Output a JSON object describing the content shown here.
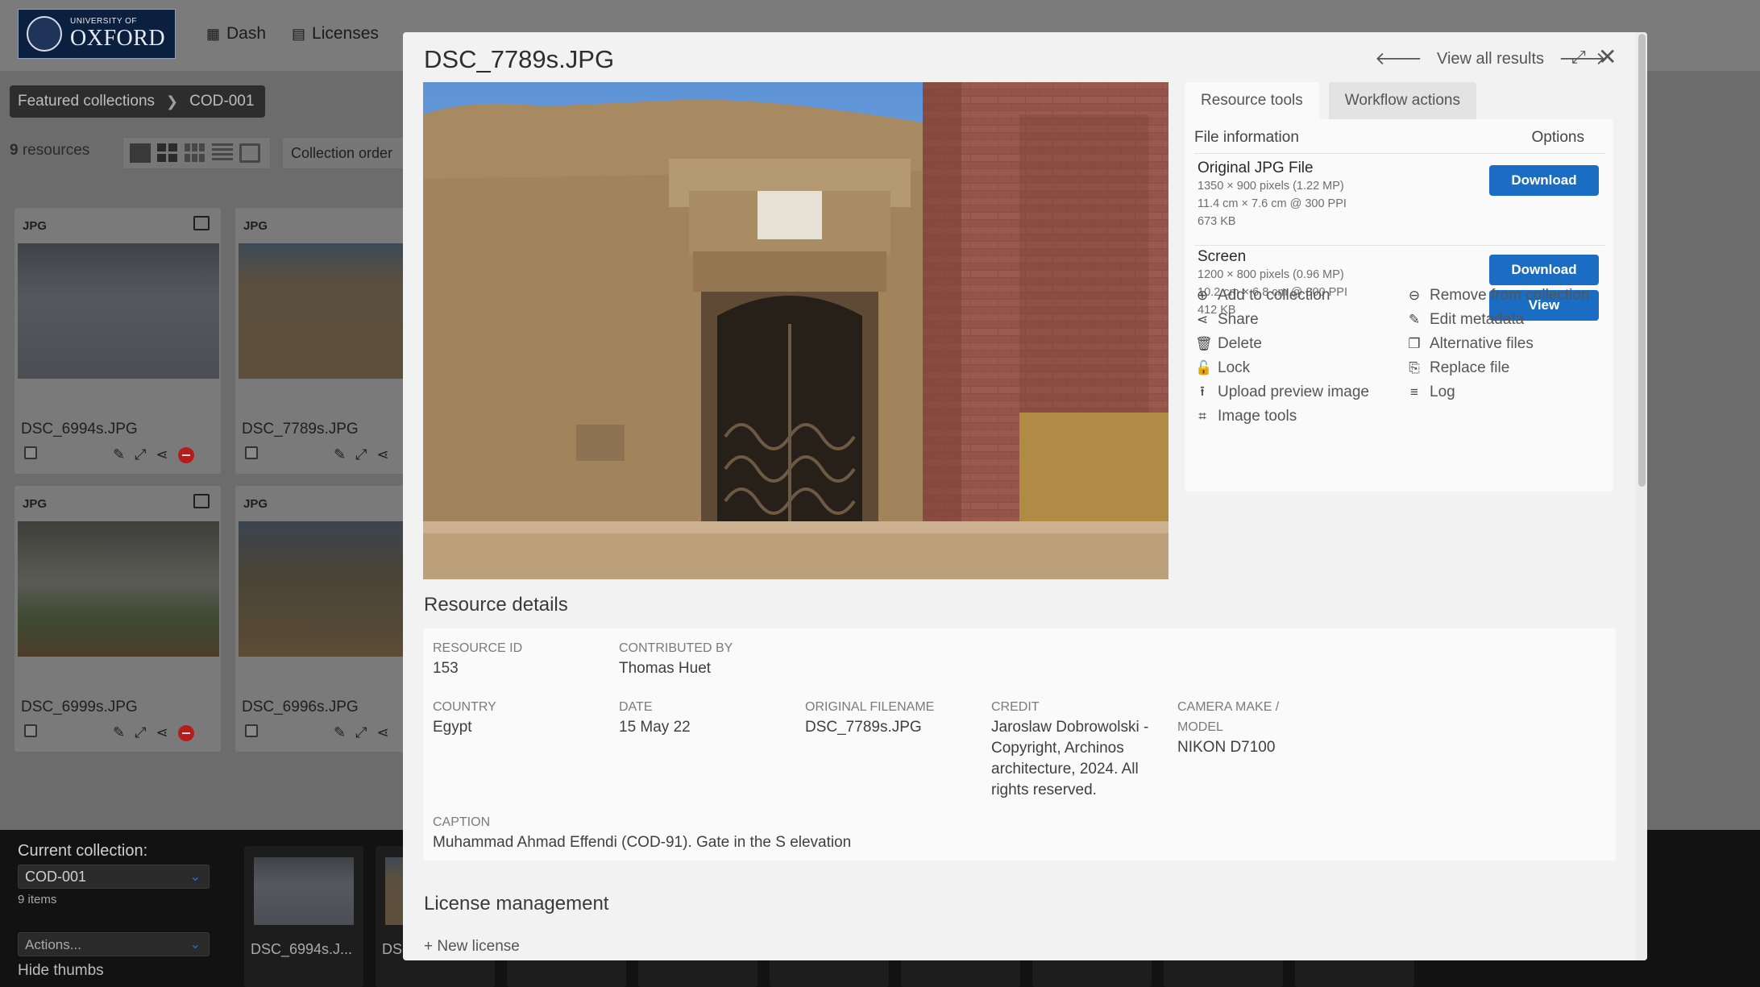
{
  "header": {
    "logo_small": "UNIVERSITY OF",
    "logo_big": "OXFORD",
    "nav": [
      {
        "label": "Dash",
        "icon": "grid-icon"
      },
      {
        "label": "Licenses",
        "icon": "license-icon"
      }
    ]
  },
  "breadcrumb": [
    "Featured collections",
    "COD-001"
  ],
  "results": {
    "count": "9",
    "label": "resources"
  },
  "collection_order": "Collection order",
  "cards": [
    {
      "type": "JPG",
      "name": "DSC_6994s.JPG"
    },
    {
      "type": "JPG",
      "name": "DSC_7789s.JPG"
    },
    {
      "type": "JPG",
      "name": "DSC_6999s.JPG"
    },
    {
      "type": "JPG",
      "name": "DSC_6996s.JPG"
    }
  ],
  "collection_bar": {
    "label": "Current collection:",
    "selected": "COD-001",
    "items": "9 items",
    "actions": "Actions...",
    "hide": "Hide thumbs",
    "thumbs": [
      "DSC_6994s.J...",
      "DSC"
    ]
  },
  "modal": {
    "title": "DSC_7789s.JPG",
    "view_all": "View all results",
    "tabs": [
      "Resource tools",
      "Workflow actions"
    ],
    "file_info_header": "File information",
    "options_header": "Options",
    "formats": [
      {
        "name": "Original JPG File",
        "dims": "1350 × 900 pixels (1.22 MP)",
        "print": "11.4 cm × 7.6 cm @ 300 PPI",
        "size": "673 KB"
      },
      {
        "name": "Screen",
        "dims": "1200 × 800 pixels (0.96 MP)",
        "print": "10.2 cm × 6.8 cm @ 300 PPI",
        "size": "412 KB"
      }
    ],
    "download_label": "Download",
    "view_label": "View",
    "actions_left": [
      {
        "label": "Add to collection",
        "icon": "plus-circle-icon"
      },
      {
        "label": "Share",
        "icon": "share-icon"
      },
      {
        "label": "Delete",
        "icon": "trash-icon"
      },
      {
        "label": "Lock",
        "icon": "lock-icon"
      },
      {
        "label": "Upload preview image",
        "icon": "upload-icon"
      },
      {
        "label": "Image tools",
        "icon": "crop-icon"
      }
    ],
    "actions_right": [
      {
        "label": "Remove from collection",
        "icon": "minus-circle-icon"
      },
      {
        "label": "Edit metadata",
        "icon": "pencil-icon"
      },
      {
        "label": "Alternative files",
        "icon": "copy-icon"
      },
      {
        "label": "Replace file",
        "icon": "file-import-icon"
      },
      {
        "label": "Log",
        "icon": "list-icon"
      }
    ],
    "details_title": "Resource details",
    "fields": {
      "resource_id": {
        "label": "Resource ID",
        "value": "153"
      },
      "contributed_by": {
        "label": "Contributed by",
        "value": "Thomas Huet"
      },
      "country": {
        "label": "Country",
        "value": "Egypt"
      },
      "date": {
        "label": "Date",
        "value": "15 May 22"
      },
      "original_filename": {
        "label": "Original filename",
        "value": "DSC_7789s.JPG"
      },
      "credit": {
        "label": "Credit",
        "value": "Jaroslaw Dobrowolski - Copyright, Archinos architecture, 2024. All rights reserved."
      },
      "camera": {
        "label": "Camera make / model",
        "value": "NIKON D7100"
      },
      "caption": {
        "label": "Caption",
        "value": "Muhammad Ahmad Effendi (COD-91). Gate in the S elevation"
      }
    },
    "license_title": "License management",
    "new_license": "New license"
  }
}
